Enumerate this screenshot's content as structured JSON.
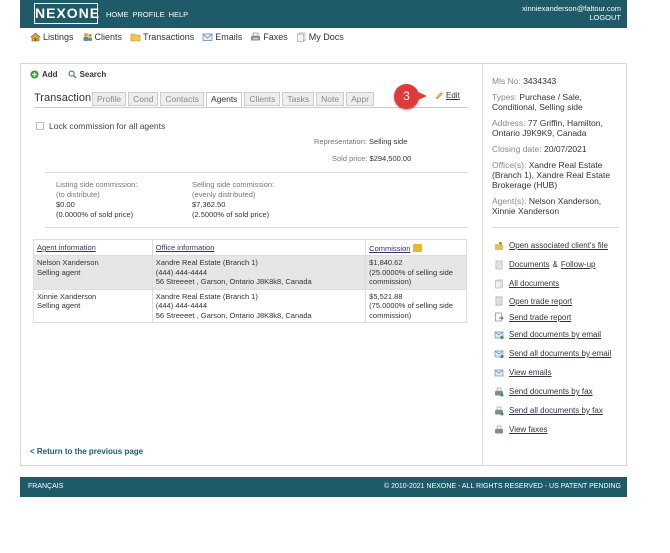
{
  "header": {
    "logo": "NEXONE",
    "nav": [
      "HOME",
      "PROFILE",
      "HELP"
    ],
    "user_email": "xinniexanderson@faltour.com",
    "logout": "LOGOUT"
  },
  "mainnav": {
    "items": [
      {
        "label": "Listings",
        "icon": "house-icon"
      },
      {
        "label": "Clients",
        "icon": "clients-icon"
      },
      {
        "label": "Transactions",
        "icon": "folder-icon"
      },
      {
        "label": "Emails",
        "icon": "envelope-icon"
      },
      {
        "label": "Faxes",
        "icon": "fax-icon"
      },
      {
        "label": "My Docs",
        "icon": "docs-icon"
      }
    ]
  },
  "actions": {
    "add": "Add",
    "search": "Search"
  },
  "tabs": {
    "section_title": "Transaction",
    "items": [
      "Profile",
      "Cond",
      "Contacts",
      "Agents",
      "Clients",
      "Tasks",
      "Note",
      "Appr"
    ],
    "active": "Agents"
  },
  "step_badge": "3",
  "edit_label": "Edit",
  "lock_all_label": "Lock commission for all agents",
  "representation": {
    "label": "Representation:",
    "value": "Selling side"
  },
  "sold_price": {
    "label": "Sold price:",
    "value": "$294,500.00"
  },
  "listing_commission": {
    "label": "Listing side commission:",
    "note": "(to distribute)",
    "amount": "$0.00",
    "pct": "(0.0000% of sold price)"
  },
  "selling_commission": {
    "label": "Selling side commission:",
    "note": "(evenly distributed)",
    "amount": "$7,362.50",
    "pct": "(2.5000% of sold price)"
  },
  "agents_table": {
    "headers": [
      "Agent information",
      "Office information",
      "Commission"
    ],
    "rows": [
      {
        "name": "Nelson Xanderson",
        "role": "Selling agent",
        "office": "Xandre Real Estate (Branch 1)",
        "phone": "(444) 444-4444",
        "address": "56 Streeeet , Garson, Ontario J8K8k8, Canada",
        "amount": "$1,840.62",
        "pct_line1": "(25.0000% of selling side",
        "pct_line2": "commission)"
      },
      {
        "name": "Xinnie Xanderson",
        "role": "Selling agent",
        "office": "Xandre Real Estate (Branch 1)",
        "phone": "(444) 444-4444",
        "address": "56 Streeeet , Garson, Ontario J8K8k8, Canada",
        "amount": "$5,521.88",
        "pct_line1": "(75.0000% of selling side",
        "pct_line2": "commission)"
      }
    ]
  },
  "return_link": "< Return to the previous page",
  "sidebar": {
    "mls_label": "Mls No:",
    "mls_value": "3434343",
    "types_label": "Types:",
    "types_value": "Purchase / Sale, Conditional, Selling side",
    "address_label": "Address:",
    "address_value": "77 Griffin, Hamilton, Ontario J9K9K9, Canada",
    "closing_label": "Closing date:",
    "closing_value": "20/07/2021",
    "offices_label": "Office(s):",
    "offices_value": "Xandre Real Estate (Branch 1), Xandre Real Estate Brokerage (HUB)",
    "agents_label": "Agent(s):",
    "agents_value": "Nelson Xanderson, Xinnie Xanderson",
    "links": {
      "open_file": "Open associated client's file",
      "documents": "Documents",
      "amp": "&",
      "followup": "Follow-up",
      "all_documents": "All documents",
      "open_trade_report": "Open trade report",
      "send_trade_report": "Send trade report",
      "send_docs_email": "Send documents by email",
      "send_all_docs_email": "Send all documents by email",
      "view_emails": "View emails",
      "send_docs_fax": "Send documents by fax",
      "send_all_docs_fax": "Send all documents by fax",
      "view_faxes": "View faxes"
    }
  },
  "footer": {
    "language": "FRANÇAIS",
    "copyright": "© 2010-2021 NEXONE - ALL RIGHTS RESERVED - US PATENT PENDING"
  }
}
